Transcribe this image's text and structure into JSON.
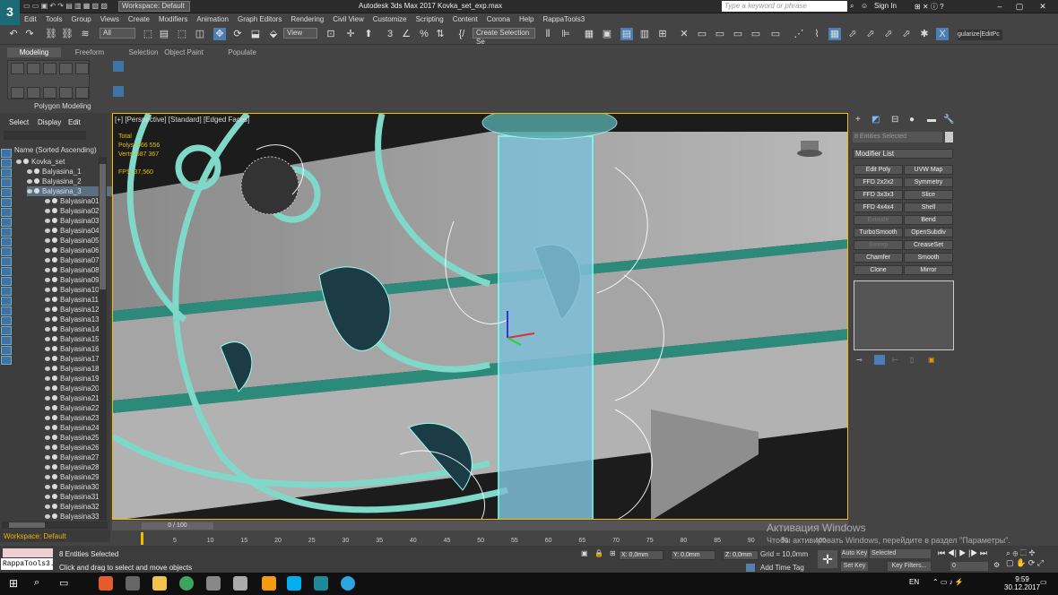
{
  "app": {
    "title": "Autodesk 3ds Max 2017    Kovka_set_exp.max",
    "logo": "3",
    "workspace": "Workspace: Default",
    "search_placeholder": "Type a keyword or phrase",
    "sign_in": "Sign In"
  },
  "menus": [
    "Edit",
    "Tools",
    "Group",
    "Views",
    "Create",
    "Modifiers",
    "Animation",
    "Graph Editors",
    "Rendering",
    "Civil View",
    "Customize",
    "Scripting",
    "Content",
    "Corona",
    "Help",
    "RappaTools3"
  ],
  "toolbar": {
    "filter": "All",
    "view": "View",
    "selection_set": "Create Selection Se",
    "unwrap": "gularize[EditPc"
  },
  "ribbon": {
    "tabs": [
      "Modeling",
      "Freeform",
      "Selection",
      "Object Paint",
      "Populate"
    ],
    "panel": "Polygon Modeling"
  },
  "scene_explorer": {
    "tabs": [
      "Select",
      "Display",
      "Edit"
    ],
    "header": "Name (Sorted Ascending)",
    "tree": [
      "Kovka_set",
      "Balyasina_1",
      "Balyasina_2",
      "Balyasina_3"
    ],
    "items": [
      "Balyasina01",
      "Balyasina02",
      "Balyasina03",
      "Balyasina04",
      "Balyasina05",
      "Balyasina06",
      "Balyasina07",
      "Balyasina08",
      "Balyasina09",
      "Balyasina10",
      "Balyasina11",
      "Balyasina12",
      "Balyasina13",
      "Balyasina14",
      "Balyasina15",
      "Balyasina16",
      "Balyasina17",
      "Balyasina18",
      "Balyasina19",
      "Balyasina20",
      "Balyasina21",
      "Balyasina22",
      "Balyasina23",
      "Balyasina24",
      "Balyasina25",
      "Balyasina26",
      "Balyasina27",
      "Balyasina28",
      "Balyasina29",
      "Balyasina30",
      "Balyasina31",
      "Balyasina32",
      "Balyasina33"
    ],
    "footer": "Workspace: Default"
  },
  "viewport": {
    "label": "[+] [Perspective] [Standard] [Edged Faces]",
    "stats": [
      "Total",
      "Polys: 566 556",
      "Verts: 587 367",
      "FPS: 37,560"
    ]
  },
  "command_panel": {
    "entities": "8 Entities Selected",
    "modifier_list": "Modifier List",
    "buttons": [
      [
        "Edit Poly",
        "UVW Map"
      ],
      [
        "FFD 2x2x2",
        "Symmetry"
      ],
      [
        "FFD 3x3x3",
        "Slice"
      ],
      [
        "FFD 4x4x4",
        "Shell"
      ],
      [
        "Extrude",
        "Bend"
      ],
      [
        "TurboSmooth",
        "OpenSubdiv"
      ],
      [
        "Sweep",
        "CreaseSet"
      ],
      [
        "Chamfer",
        "Smooth"
      ],
      [
        "Clone",
        "Mirror"
      ]
    ],
    "disabled": [
      "Extrude",
      "Sweep"
    ]
  },
  "timeline": {
    "slider": "0 / 100",
    "ticks": [
      "5",
      "10",
      "15",
      "20",
      "25",
      "30",
      "35",
      "40",
      "45",
      "50",
      "55",
      "60",
      "65",
      "70",
      "75",
      "80",
      "85",
      "90",
      "95",
      "100"
    ]
  },
  "status": {
    "rappa": "RappaTools3.",
    "selected": "8 Entities Selected",
    "prompt": "Click and drag to select and move objects",
    "x": "X: 0,0mm",
    "y": "Y: 0,0mm",
    "z": "Z: 0,0mm",
    "grid": "Grid = 10,0mm",
    "add_time_tag": "Add Time Tag",
    "auto_key": "Auto Key",
    "selected_dd": "Selected",
    "set_key": "Set Key",
    "key_filters": "Key Filters...",
    "frame": "0"
  },
  "watermark": {
    "line1": "Активация Windows",
    "line2": "Чтобы активировать Windows, перейдите в раздел \"Параметры\"."
  },
  "taskbar": {
    "lang": "EN",
    "time": "9:59",
    "date": "30.12.2017"
  }
}
